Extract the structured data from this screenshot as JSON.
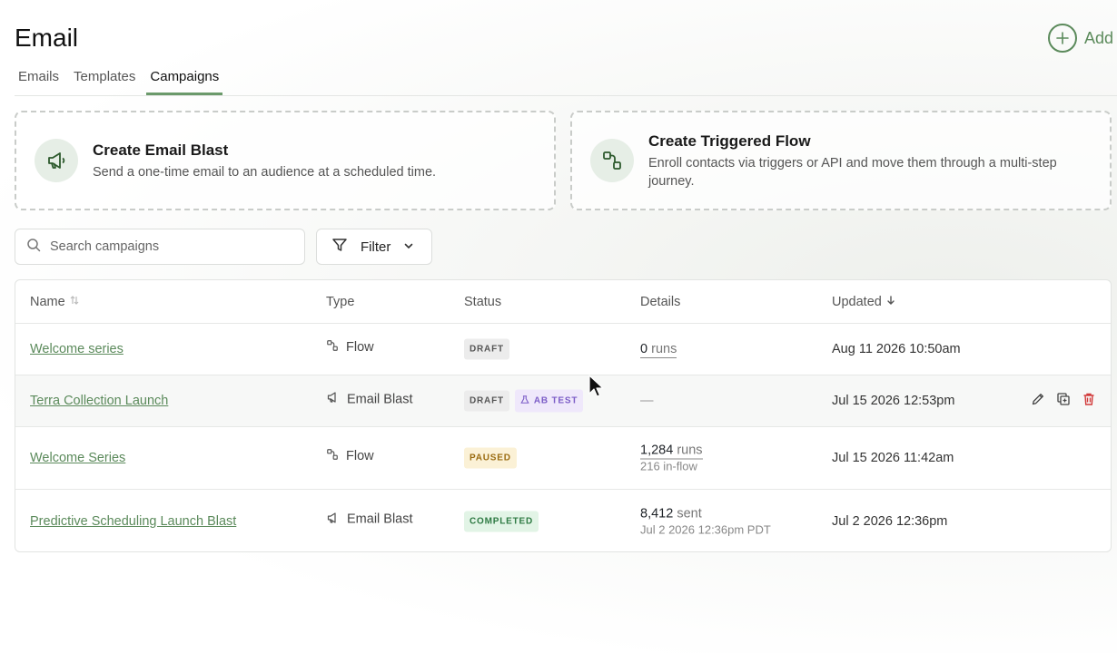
{
  "page": {
    "title": "Email",
    "add_label": "Add"
  },
  "tabs": [
    {
      "label": "Emails",
      "active": false
    },
    {
      "label": "Templates",
      "active": false
    },
    {
      "label": "Campaigns",
      "active": true
    }
  ],
  "cards": {
    "blast": {
      "title": "Create Email Blast",
      "desc": "Send a one-time email to an audience at a scheduled time.",
      "icon": "megaphone-icon"
    },
    "flow": {
      "title": "Create Triggered Flow",
      "desc": "Enroll contacts via triggers or API and move them through a multi-step journey.",
      "icon": "flow-icon"
    }
  },
  "search": {
    "placeholder": "Search campaigns"
  },
  "filter": {
    "label": "Filter"
  },
  "table": {
    "headers": {
      "name": "Name",
      "type": "Type",
      "status": "Status",
      "details": "Details",
      "updated": "Updated"
    },
    "rows": [
      {
        "name": "Welcome series",
        "type": "Flow",
        "status": "DRAFT",
        "detail_num": "0",
        "detail_unit": "runs",
        "detail_sub": "",
        "updated": "Aug 11 2026 10:50am"
      },
      {
        "name": "Terra Collection Launch",
        "type": "Email Blast",
        "status": "DRAFT",
        "status2": "AB TEST",
        "detail_dash": "—",
        "updated": "Jul 15 2026 12:53pm"
      },
      {
        "name": "Welcome Series",
        "type": "Flow",
        "status": "PAUSED",
        "detail_num": "1,284",
        "detail_unit": "runs",
        "detail_sub": "216 in-flow",
        "updated": "Jul 15 2026 11:42am"
      },
      {
        "name": "Predictive Scheduling Launch Blast",
        "type": "Email Blast",
        "status": "COMPLETED",
        "detail_num": "8,412",
        "detail_unit": "sent",
        "detail_sub": "Jul 2 2026 12:36pm PDT",
        "updated": "Jul 2 2026 12:36pm"
      }
    ]
  },
  "colors": {
    "accent": "#5b8a5b",
    "delete": "#d23b3b"
  }
}
